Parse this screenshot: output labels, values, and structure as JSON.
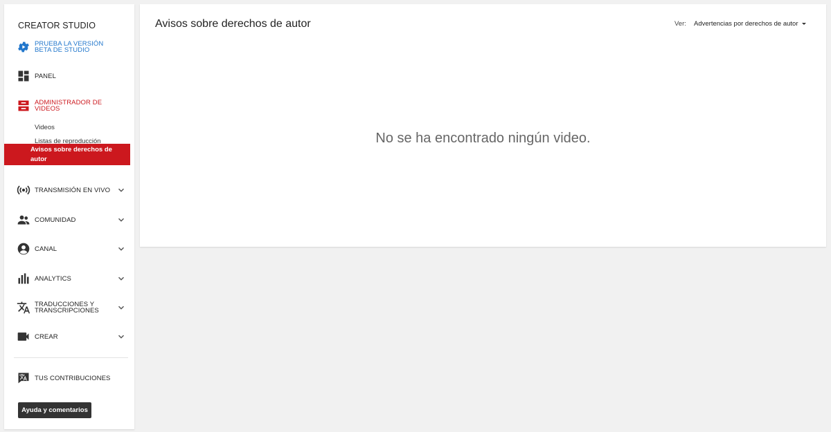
{
  "sidebar": {
    "brand": "CREATOR STUDIO",
    "beta": {
      "label": "PRUEBA LA VERSIÓN BETA DE STUDIO",
      "icon": "gear-icon"
    },
    "panel": {
      "label": "PANEL",
      "icon": "dashboard-icon"
    },
    "video_manager": {
      "label": "ADMINISTRADOR DE VIDEOS",
      "icon": "video-manager-icon",
      "subitems": [
        "Videos",
        "Listas de reproducción"
      ],
      "active_subitem": "Avisos sobre derechos de autor"
    },
    "live": {
      "label": "TRANSMISIÓN EN VIVO",
      "icon": "live-broadcast-icon"
    },
    "community": {
      "label": "COMUNIDAD",
      "icon": "people-icon"
    },
    "channel": {
      "label": "CANAL",
      "icon": "account-circle-icon"
    },
    "analytics": {
      "label": "ANALYTICS",
      "icon": "bar-chart-icon"
    },
    "translations": {
      "label": "TRADUCCIONES Y TRANSCRIPCIONES",
      "icon": "translate-icon"
    },
    "create": {
      "label": "CREAR",
      "icon": "video-camera-icon"
    },
    "contributions": {
      "label": "TUS CONTRIBUCIONES",
      "icon": "translate-box-icon"
    },
    "help_button": "Ayuda y comentarios"
  },
  "main": {
    "title": "Avisos sobre derechos de autor",
    "view_label": "Ver:",
    "view_value": "Advertencias por derechos de autor",
    "empty_message": "No se ha encontrado ningún video."
  },
  "colors": {
    "accent_red": "#cc181e",
    "link_blue": "#2277cc",
    "page_bg": "#f1f1f1",
    "button_dark": "#333333"
  }
}
